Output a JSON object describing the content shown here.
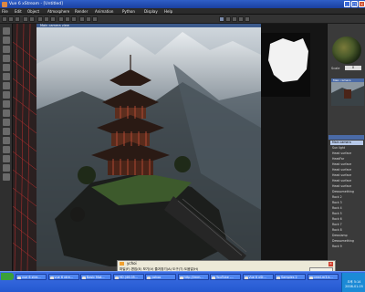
{
  "app": {
    "title": "Vue 6 xStream - [Untitled]"
  },
  "menu": [
    "File",
    "Edit",
    "Object",
    "Atmosphere",
    "Render",
    "Animation",
    "Python",
    "Display",
    "Help"
  ],
  "viewport": {
    "title": "Main camera view"
  },
  "right_panel": {
    "scale_label": "Scale",
    "scale_value": "0",
    "camera_label": "Main camera",
    "layers": [
      "Main camera",
      "Sun light",
      "Head surface",
      "HeadFar",
      "Head surface",
      "Head surface",
      "Head surface",
      "Head surface",
      "Head surface",
      "Dewsomething",
      "Rock 2",
      "Rock 3",
      "Rock 4",
      "Rock 5",
      "Rock 6",
      "Rock 7",
      "Rock 8",
      "Dewslamp",
      "Dewsomething",
      "Rock 9"
    ],
    "selected_layer_index": 0
  },
  "taskbar": {
    "tasks": [
      "vue 6 xtre...",
      "vue 6 xtre...",
      "Basic Mat...",
      "HD.(46.05...",
      "yahoo",
      "http://imm...",
      "YouTube -...",
      "Vue 6 xSt...",
      "Samples 2",
      "ceed-m3.k..."
    ],
    "clock_time": "오후 5:14",
    "clock_date": "2008-01-05"
  },
  "ime": {
    "title": "ychoi",
    "menu": "파일(F) 편집(E) 보기(V) 즐겨찾기(A) 도구(T) 도움말(H)"
  }
}
